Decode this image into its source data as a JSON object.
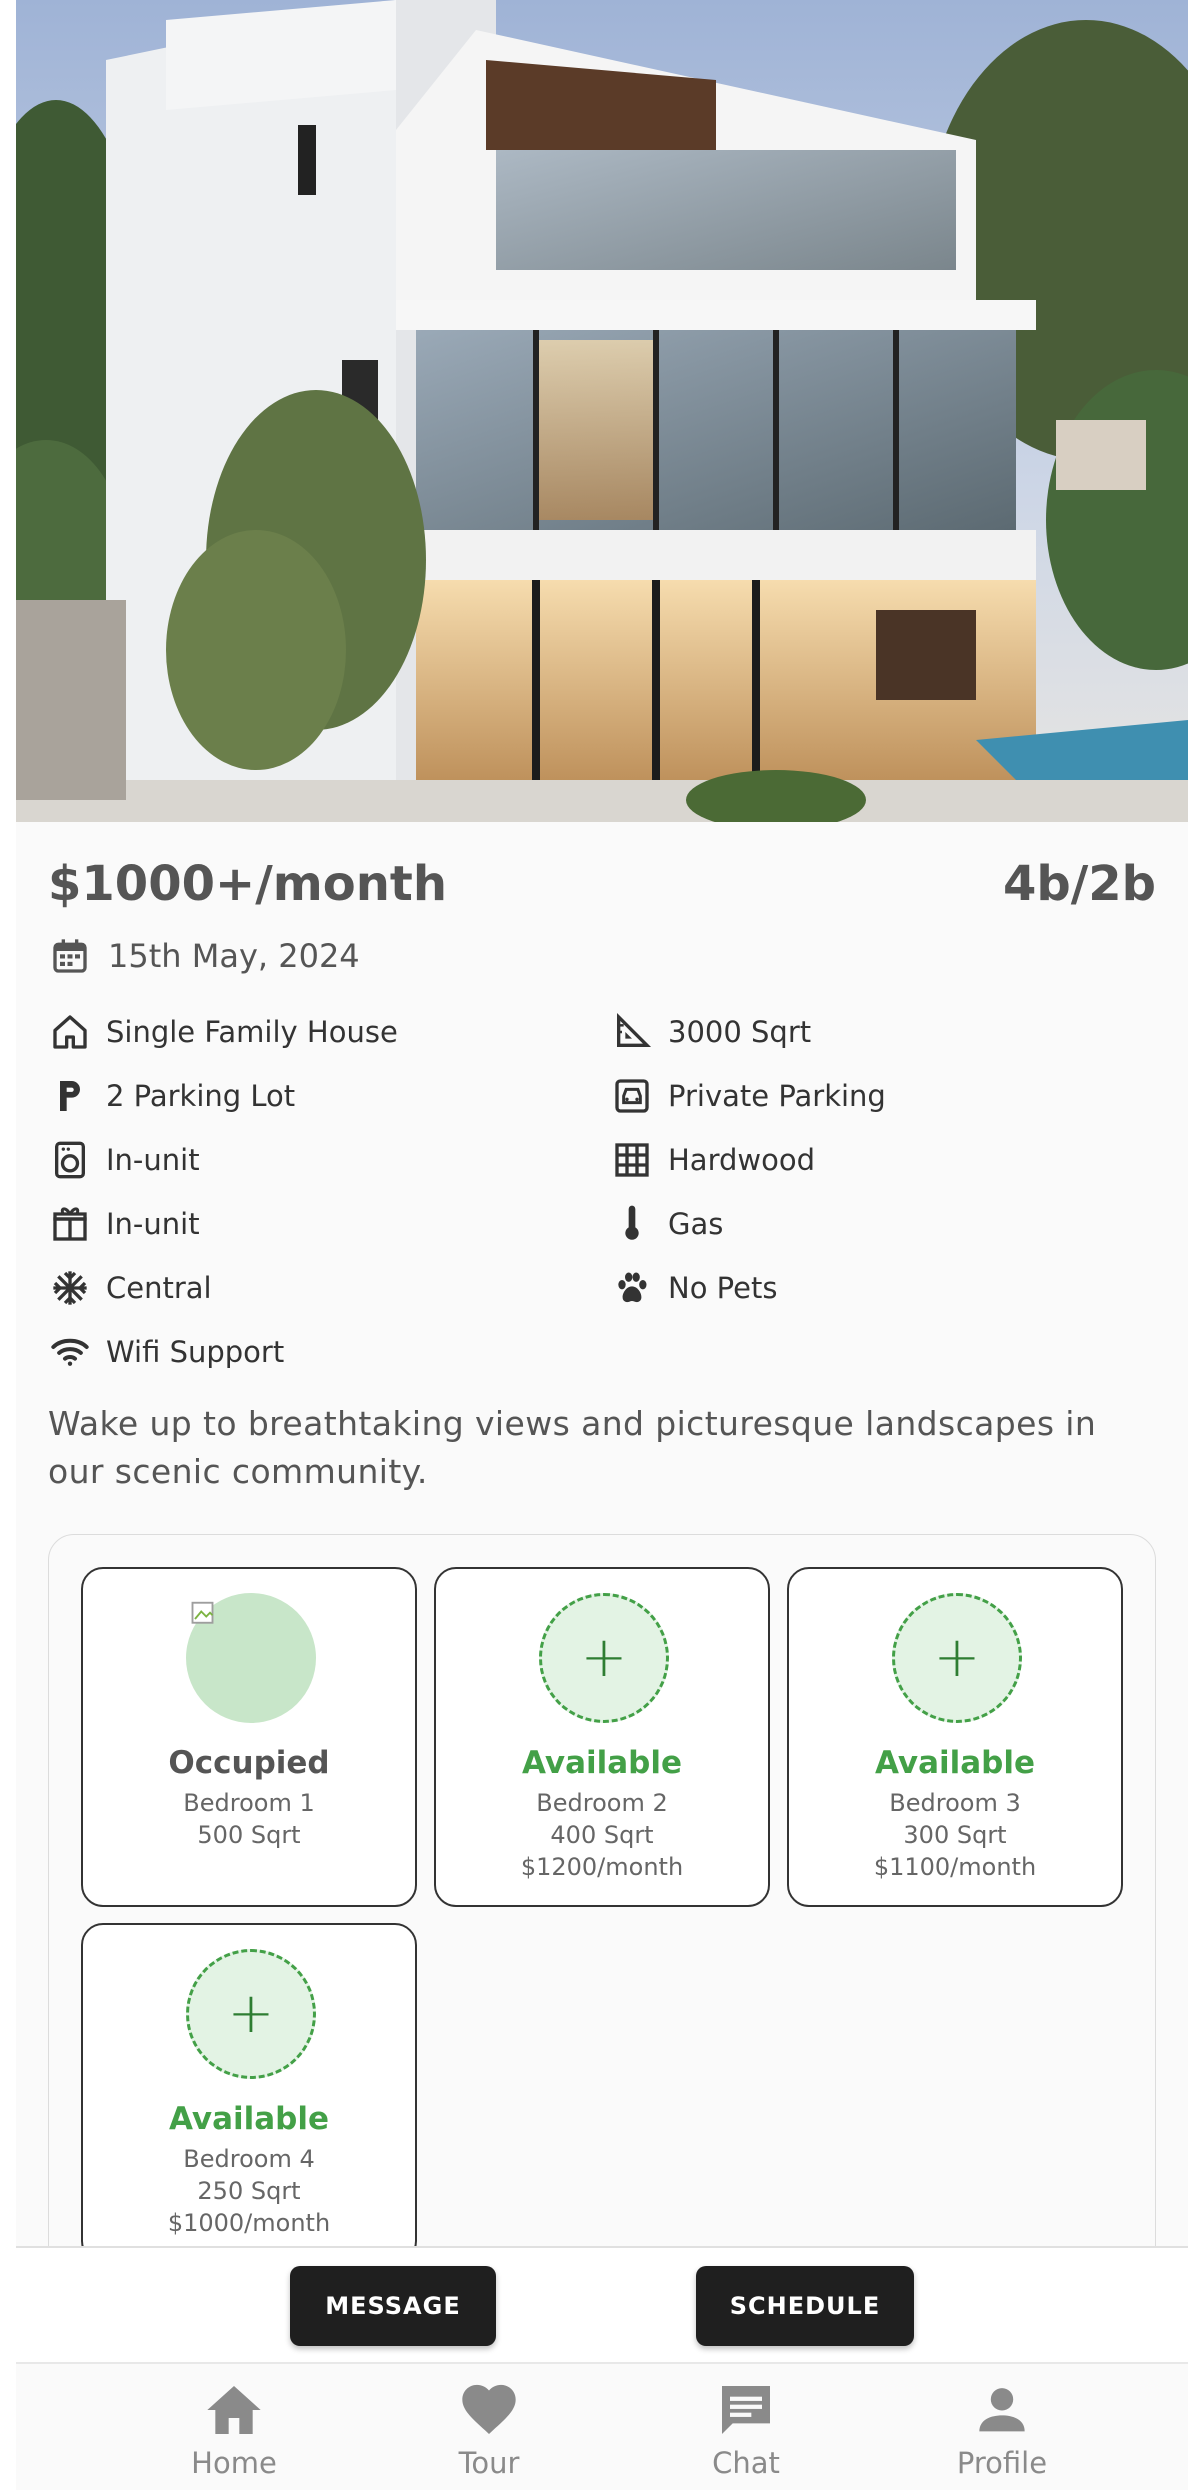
{
  "listing": {
    "price": "$1000+/month",
    "beds_baths": "4b/2b",
    "date": "15th May, 2024",
    "features": [
      {
        "icon": "house-icon",
        "label": "Single Family House"
      },
      {
        "icon": "area-ruler-icon",
        "label": "3000 Sqrt"
      },
      {
        "icon": "parking-icon",
        "label": "2 Parking Lot"
      },
      {
        "icon": "car-garage-icon",
        "label": "Private Parking"
      },
      {
        "icon": "washer-icon",
        "label": "In-unit"
      },
      {
        "icon": "floor-grid-icon",
        "label": "Hardwood"
      },
      {
        "icon": "dishwasher-icon",
        "label": "In-unit"
      },
      {
        "icon": "thermometer-icon",
        "label": "Gas"
      },
      {
        "icon": "snowflake-icon",
        "label": "Central"
      },
      {
        "icon": "paw-icon",
        "label": "No Pets"
      },
      {
        "icon": "wifi-icon",
        "label": "Wifi Support"
      }
    ],
    "description": "Wake up to breathtaking views and picturesque landscapes in our scenic community."
  },
  "rooms": [
    {
      "status": "Occupied",
      "name": "Bedroom 1",
      "size": "500 Sqrt",
      "price": ""
    },
    {
      "status": "Available",
      "name": "Bedroom 2",
      "size": "400 Sqrt",
      "price": "$1200/month"
    },
    {
      "status": "Available",
      "name": "Bedroom 3",
      "size": "300 Sqrt",
      "price": "$1100/month"
    },
    {
      "status": "Available",
      "name": "Bedroom 4",
      "size": "250 Sqrt",
      "price": "$1000/month"
    }
  ],
  "room_plus_symbol": "+",
  "actions": {
    "message_label": "MESSAGE",
    "schedule_label": "SCHEDULE"
  },
  "tabs": [
    {
      "icon": "home-icon",
      "label": "Home"
    },
    {
      "icon": "heart-icon",
      "label": "Tour"
    },
    {
      "icon": "chat-icon",
      "label": "Chat"
    },
    {
      "icon": "profile-icon",
      "label": "Profile"
    }
  ],
  "colors": {
    "available_green": "#43a047",
    "occupied_fill": "#c8e6c9",
    "button_dark": "#1f1f1f",
    "tab_gray": "#8a8a8a"
  }
}
